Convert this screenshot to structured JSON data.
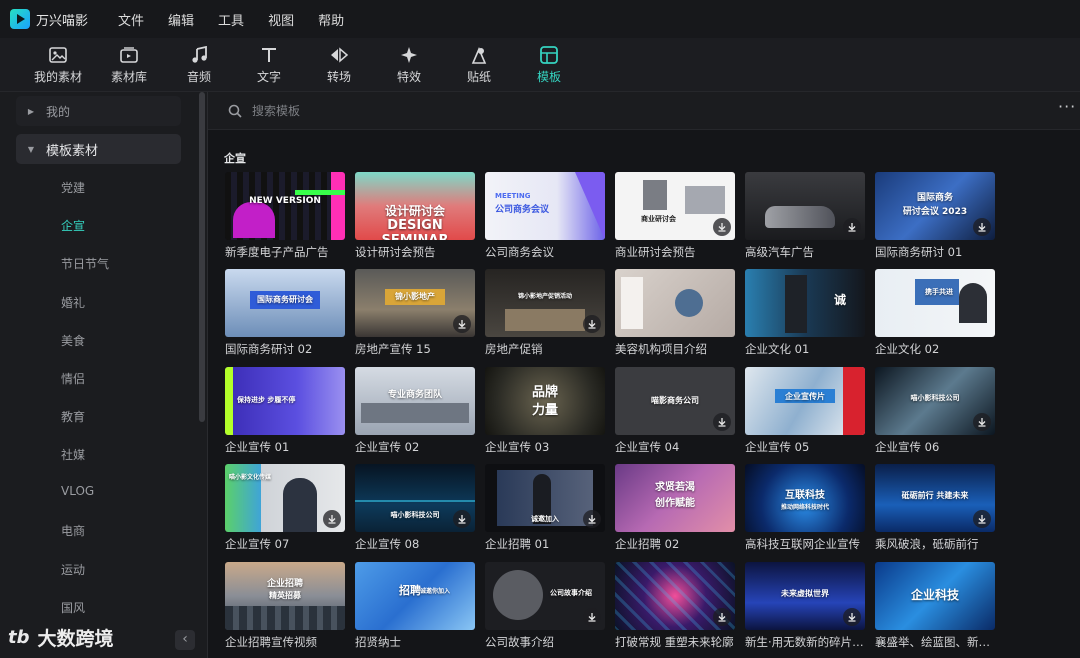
{
  "app": {
    "name": "万兴喵影"
  },
  "menu": [
    "文件",
    "编辑",
    "工具",
    "视图",
    "帮助"
  ],
  "toolbar": [
    {
      "label": "我的素材",
      "icon": "image-icon"
    },
    {
      "label": "素材库",
      "icon": "library-icon"
    },
    {
      "label": "音频",
      "icon": "music-note-icon"
    },
    {
      "label": "文字",
      "icon": "text-icon"
    },
    {
      "label": "转场",
      "icon": "transition-icon"
    },
    {
      "label": "特效",
      "icon": "effects-icon"
    },
    {
      "label": "贴纸",
      "icon": "sticker-icon"
    },
    {
      "label": "模板",
      "icon": "template-icon",
      "active": true
    }
  ],
  "sidebar": {
    "mine": "我的",
    "group": "模板素材",
    "categories": [
      "党建",
      "企宣",
      "节日节气",
      "婚礼",
      "美食",
      "情侣",
      "教育",
      "社媒",
      "VLOG",
      "电商",
      "运动",
      "国风"
    ],
    "active_category": "企宣"
  },
  "search": {
    "placeholder": "搜索模板"
  },
  "section": {
    "title": "企宣"
  },
  "templates": [
    {
      "title": "新季度电子产品广告",
      "thumb": [
        "NEW VERSION"
      ]
    },
    {
      "title": "设计研讨会预告",
      "thumb": [
        "设计研讨会",
        "DESIGN SEMINAR"
      ]
    },
    {
      "title": "公司商务会议",
      "thumb": [
        "MEETING",
        "公司商务会议"
      ]
    },
    {
      "title": "商业研讨会预告",
      "thumb": [
        "商业研讨会"
      ]
    },
    {
      "title": "高级汽车广告",
      "thumb": []
    },
    {
      "title": "国际商务研讨 01",
      "thumb": [
        "国际商务",
        "研讨会议 2023"
      ]
    },
    {
      "title": "国际商务研讨 02",
      "thumb": [
        "国际商务研讨会"
      ]
    },
    {
      "title": "房地产宣传 15",
      "thumb": [
        "锦小影地产"
      ]
    },
    {
      "title": "房地产促销",
      "thumb": [
        "锦小影地产促销活动"
      ]
    },
    {
      "title": "美容机构项目介绍",
      "thumb": []
    },
    {
      "title": "企业文化 01",
      "thumb": [
        "诚"
      ]
    },
    {
      "title": "企业文化 02",
      "thumb": [
        "携手共进"
      ]
    },
    {
      "title": "企业宣传 01",
      "thumb": [
        "保持进步 步履不停"
      ]
    },
    {
      "title": "企业宣传 02",
      "thumb": [
        "专业商务团队"
      ]
    },
    {
      "title": "企业宣传 03",
      "thumb": [
        "品牌",
        "力量"
      ]
    },
    {
      "title": "企业宣传 04",
      "thumb": [
        "喵影商务公司"
      ]
    },
    {
      "title": "企业宣传 05",
      "thumb": [
        "企业宣传片"
      ]
    },
    {
      "title": "企业宣传 06",
      "thumb": [
        "喵小影科技公司"
      ]
    },
    {
      "title": "企业宣传 07",
      "thumb": [
        "喵小影文化传媒"
      ]
    },
    {
      "title": "企业宣传 08",
      "thumb": [
        "喵小影科技公司"
      ]
    },
    {
      "title": "企业招聘 01",
      "thumb": [
        "诚邀加入"
      ]
    },
    {
      "title": "企业招聘 02",
      "thumb": [
        "求贤若渴",
        "创作赋能"
      ]
    },
    {
      "title": "高科技互联网企业宣传",
      "thumb": [
        "互联科技",
        "推动网络科技时代"
      ]
    },
    {
      "title": "乘风破浪，砥砺前行",
      "thumb": [
        "砥砺前行 共建未来"
      ]
    },
    {
      "title": "企业招聘宣传视频",
      "thumb": [
        "企业招聘",
        "精英招募"
      ]
    },
    {
      "title": "招贤纳士",
      "thumb": [
        "招聘",
        "诚邀你加入"
      ]
    },
    {
      "title": "公司故事介绍",
      "thumb": [
        "公司故事介绍"
      ]
    },
    {
      "title": "打破常规 重塑未来轮廓",
      "thumb": []
    },
    {
      "title": "新生·用无数新的碎片…",
      "thumb": [
        "未来虚拟世界"
      ]
    },
    {
      "title": "襄盛举、绘蓝图、新…",
      "thumb": [
        "企业科技"
      ]
    }
  ],
  "watermark": {
    "logo": "tb",
    "text": "大数跨境"
  }
}
